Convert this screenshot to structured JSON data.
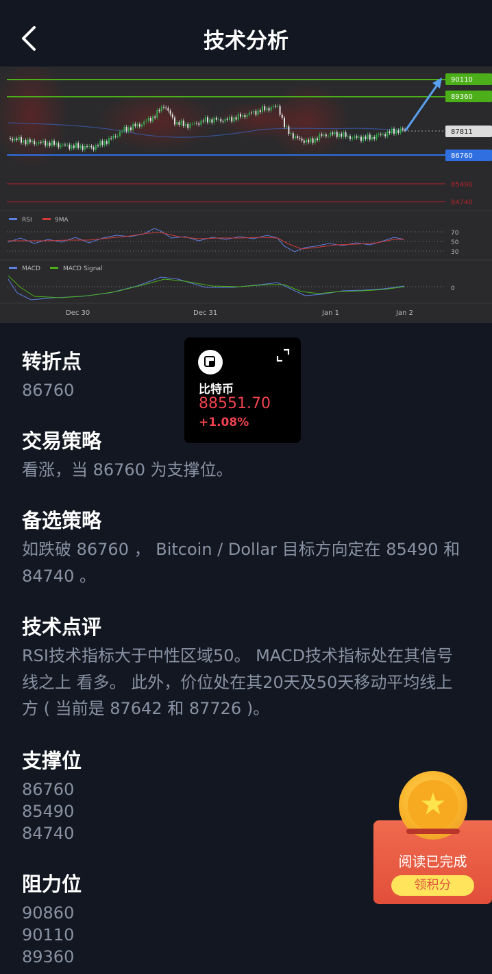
{
  "header": {
    "title": "技术分析"
  },
  "chart": {
    "price_tags": [
      {
        "label": "90110",
        "color": "#4caf1a"
      },
      {
        "label": "89360",
        "color": "#4caf1a"
      },
      {
        "label": "87811",
        "color": "#dddddd"
      },
      {
        "label": "86760",
        "color": "#2f6fe0"
      },
      {
        "label": "85490",
        "color": "#b3232a"
      },
      {
        "label": "84740",
        "color": "#b3232a"
      }
    ],
    "rsi_legend": [
      "RSI",
      "9MA"
    ],
    "rsi_levels": [
      "70",
      "50",
      "30"
    ],
    "macd_legend": [
      "MACD",
      "MACD Signal"
    ],
    "macd_zero": "0",
    "x_ticks": [
      "Dec 30",
      "Dec 31",
      "Jan 1",
      "Jan 2"
    ]
  },
  "sections": {
    "turning_point": {
      "title": "转折点",
      "body": "86760"
    },
    "strategy": {
      "title": "交易策略",
      "body": "看涨，当 86760 为支撑位。"
    },
    "alt_strategy": {
      "title": "备选策略",
      "body": "如跌破 86760 ， Bitcoin / Dollar 目标方向定在 85490 和 84740 。"
    },
    "comment": {
      "title": "技术点评",
      "body": "RSI技术指标大于中性区域50。 MACD技术指标处在其信号线之上 看多。 此外，价位处在其20天及50天移动平均线上方 ( 当前是 87642 和 87726 )。"
    },
    "support": {
      "title": "支撑位",
      "levels": [
        "86760",
        "85490",
        "84740"
      ]
    },
    "resistance": {
      "title": "阻力位",
      "levels": [
        "90860",
        "90110",
        "89360"
      ]
    }
  },
  "float_card": {
    "name": "比特币",
    "price": "88551.70",
    "change": "+1.08%"
  },
  "reward": {
    "status": "阅读已完成",
    "button": "领积分"
  },
  "colors": {
    "background": "#121722",
    "up": "#f2424f",
    "muted_text": "#8a93a3"
  }
}
